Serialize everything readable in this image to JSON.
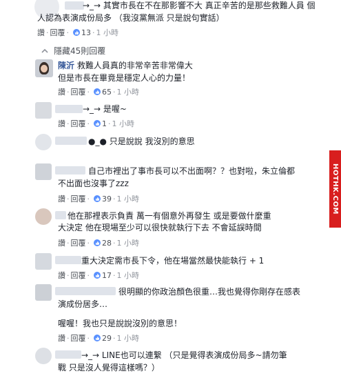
{
  "side_tag": "HOTHK.COM",
  "hidden_replies": "隱藏45則回覆",
  "actions": {
    "read": "讚",
    "reply": "回覆"
  },
  "comments": [
    {
      "line1": "→_→ 其實市長在不在那影響不大 真正辛苦的是那些救難人員 個",
      "line2": "人認為表演成份局多 （我沒黨無派 只是說句實話）",
      "likes": "13",
      "time": "1 小時"
    },
    {
      "author": "陳沂",
      "line1": "救難人員真的非常辛苦非常偉大",
      "line2": "但是市長在畢竟是穩定人心的力量！",
      "likes": "65",
      "time": "1 小時"
    },
    {
      "line1": "→_→ 是喔~",
      "likes": "1",
      "time": "1 小時"
    },
    {
      "line1": "●_● 只是說說 我沒別的意思"
    },
    {
      "line1": "自己市裡出了事市長可以不出面啊？？也對啦，朱立倫都",
      "line2": "不出面也沒事了zzz",
      "likes": "39",
      "time": "1 小時"
    },
    {
      "line1": "他在那裡表示負責 萬一有個意外再發生 或是要做什麼重",
      "line2": "大決定 他在現場至少可以很快就執行下去 不會延誤時間",
      "likes": "28",
      "time": "1 小時"
    },
    {
      "line1": "重大決定需市長下令，他在場當然最快能執行 + 1",
      "likes": "17",
      "time": "1 小時"
    },
    {
      "line1": "很明顯的你政治顏色很重…我也覺得你剛存在感表",
      "line2": "演成份居多…",
      "line3": "喔喔！我也只是說說沒別的意思！",
      "likes": "29",
      "time": "1 小時"
    },
    {
      "line1": "→_→ LINE也可以連繫 （只是覺得表演成份局多~請勿筆",
      "line2": "戰 只是沒人覺得這樣嗎？）"
    }
  ]
}
